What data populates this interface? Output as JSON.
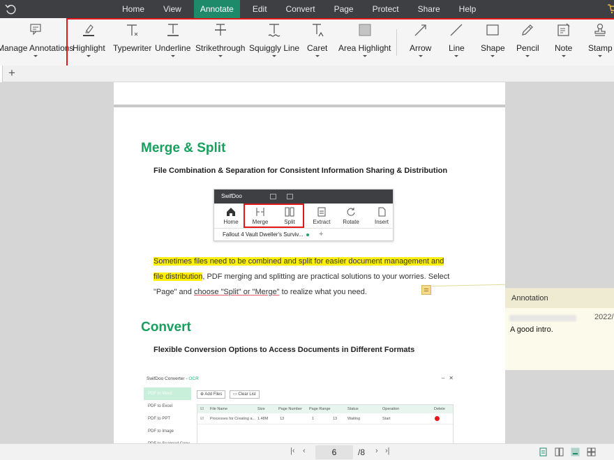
{
  "menu": {
    "tabs": [
      {
        "label": "Home"
      },
      {
        "label": "View"
      },
      {
        "label": "Annotate"
      },
      {
        "label": "Edit"
      },
      {
        "label": "Convert"
      },
      {
        "label": "Page"
      },
      {
        "label": "Protect"
      },
      {
        "label": "Share"
      },
      {
        "label": "Help"
      }
    ],
    "active_tab": "Annotate",
    "active_color": "#1e8a6a"
  },
  "ribbon": {
    "manage": "Manage Annotations",
    "tools": {
      "highlight": "Highlight",
      "typewriter": "Typewriter",
      "underline": "Underline",
      "strikethrough": "Strikethrough",
      "squiggly": "Squiggly Line",
      "caret": "Caret",
      "area_highlight": "Area Highlight",
      "arrow": "Arrow",
      "line": "Line",
      "shape": "Shape",
      "pencil": "Pencil",
      "note": "Note",
      "stamp": "Stamp"
    }
  },
  "doc": {
    "h1": "Merge & Split",
    "sub1": "File Combination & Separation for Consistent Information Sharing & Distribution",
    "para1_hl1": "Sometimes files need to be combined and split for easier document management and",
    "para1_hl2": "file distribution",
    "para1_rest": ", PDF merging and splitting are practical solutions to your worries. Select",
    "para1_line3a": "\"Page\" and ",
    "para1_ul": "choose \"Split\" or \"Merge\"",
    "para1_line3b": " to realize what you need.",
    "h2": "Convert",
    "sub2": "Flexible Conversion Options to Access Documents in Different Formats",
    "shot1": {
      "app": "SwifDoo",
      "items": [
        "Home",
        "Merge",
        "Split",
        "Extract",
        "Rotate",
        "Insert"
      ],
      "file_tab": "Fallout 4 Vault Dweller's Surviv..."
    },
    "shot2": {
      "title": "SwifDoo Converter -",
      "title_tag": "OCR",
      "sidebar": [
        "PDF to Word",
        "PDF to Excel",
        "PDF to PPT",
        "PDF to Image",
        "PDF to Scanned Copy"
      ],
      "add_files": "Add Files",
      "clear_list": "Clear List",
      "headers": [
        "File Name",
        "Size",
        "Page Number",
        "Page Range",
        "Status",
        "Operation",
        "Delete"
      ],
      "row": {
        "name": "Processes for Creating a...",
        "size": "1.48M",
        "pages": "13",
        "from": "1",
        "to": "13",
        "status": "Waiting",
        "op": "Start"
      }
    }
  },
  "annotation": {
    "header": "Annotation",
    "date": "2022/",
    "text": "A good intro."
  },
  "status": {
    "page": "6",
    "total": "/8"
  }
}
